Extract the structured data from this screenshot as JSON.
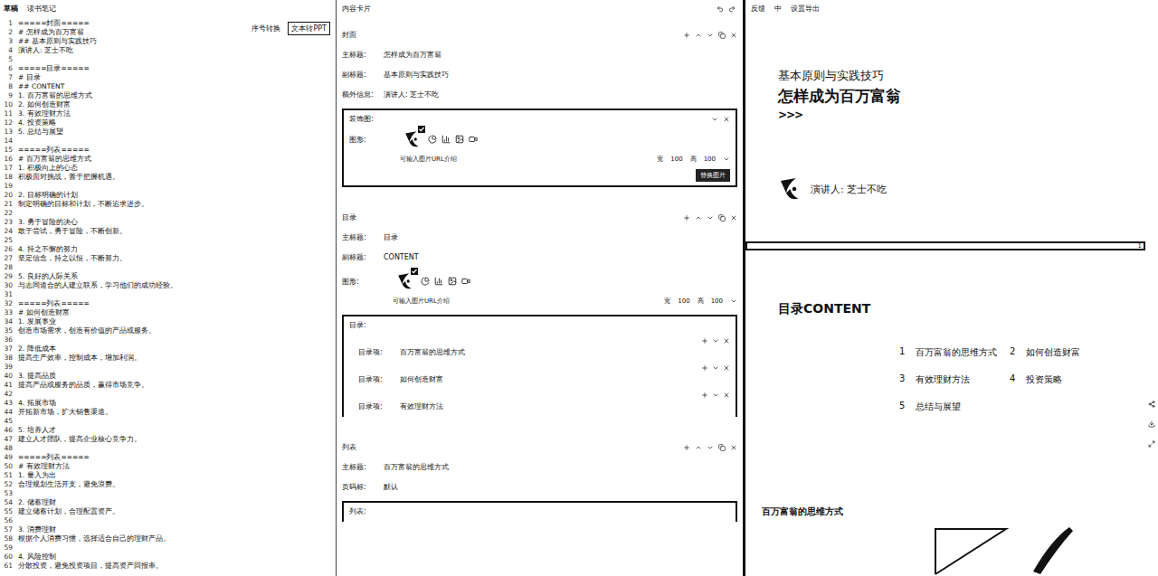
{
  "editor": {
    "tabs": [
      {
        "label": "草稿",
        "selected": true
      },
      {
        "label": "读书笔记",
        "selected": false
      }
    ],
    "buttons": [
      {
        "label": "序号转换",
        "selected": false
      },
      {
        "label": "文本转PPT",
        "selected": true
      }
    ],
    "lines": [
      {
        "n": "1",
        "text": "=====封面====="
      },
      {
        "n": "2",
        "text": "# 怎样成为百万富翁"
      },
      {
        "n": "3",
        "text": "## 基本原则与实践技巧"
      },
      {
        "n": "4",
        "text": "演讲人: 芝士不吃"
      },
      {
        "n": "5",
        "text": ""
      },
      {
        "n": "6",
        "text": "=====目录====="
      },
      {
        "n": "7",
        "text": "# 目录"
      },
      {
        "n": "8",
        "text": "## CONTENT"
      },
      {
        "n": "9",
        "text": "1. 百万富翁的思维方式"
      },
      {
        "n": "10",
        "text": "2. 如何创造财富"
      },
      {
        "n": "11",
        "text": "3. 有效理财方法"
      },
      {
        "n": "12",
        "text": "4. 投资策略"
      },
      {
        "n": "13",
        "text": "5. 总结与展望"
      },
      {
        "n": "14",
        "text": ""
      },
      {
        "n": "15",
        "text": "=====列表====="
      },
      {
        "n": "16",
        "text": "# 百万富翁的思维方式"
      },
      {
        "n": "17",
        "text": "1. 积极向上的心态"
      },
      {
        "n": "18",
        "text": "积极面对挑战，善于把握机遇。"
      },
      {
        "n": "19",
        "text": ""
      },
      {
        "n": "20",
        "text": "2. 目标明确的计划"
      },
      {
        "n": "21",
        "text": "制定明确的目标和计划，不断追求进步。"
      },
      {
        "n": "22",
        "text": ""
      },
      {
        "n": "23",
        "text": "3. 勇于冒险的决心"
      },
      {
        "n": "24",
        "text": "敢于尝试，勇于冒险，不断创新。"
      },
      {
        "n": "25",
        "text": ""
      },
      {
        "n": "26",
        "text": "4. 持之不懈的努力"
      },
      {
        "n": "27",
        "text": "坚定信念，持之以恒，不断努力。"
      },
      {
        "n": "28",
        "text": ""
      },
      {
        "n": "29",
        "text": "5. 良好的人际关系"
      },
      {
        "n": "30",
        "text": "与志同道合的人建立联系，学习他们的成功经验。"
      },
      {
        "n": "31",
        "text": ""
      },
      {
        "n": "32",
        "text": "=====列表====="
      },
      {
        "n": "33",
        "text": "# 如何创造财富"
      },
      {
        "n": "34",
        "text": "1. 发展事业"
      },
      {
        "n": "35",
        "text": "创造市场需求，创造有价值的产品或服务。"
      },
      {
        "n": "36",
        "text": ""
      },
      {
        "n": "37",
        "text": "2. 降低成本"
      },
      {
        "n": "38",
        "text": "提高生产效率，控制成本，增加利润。"
      },
      {
        "n": "39",
        "text": ""
      },
      {
        "n": "40",
        "text": "3. 提高品质"
      },
      {
        "n": "41",
        "text": "提高产品或服务的品质，赢得市场竞争。"
      },
      {
        "n": "42",
        "text": ""
      },
      {
        "n": "43",
        "text": "4. 拓展市场"
      },
      {
        "n": "44",
        "text": "开拓新市场，扩大销售渠道。"
      },
      {
        "n": "45",
        "text": ""
      },
      {
        "n": "46",
        "text": "5. 培养人才"
      },
      {
        "n": "47",
        "text": "建立人才团队，提高企业核心竞争力。"
      },
      {
        "n": "48",
        "text": ""
      },
      {
        "n": "49",
        "text": "=====列表====="
      },
      {
        "n": "50",
        "text": "# 有效理财方法"
      },
      {
        "n": "51",
        "text": "1. 量入为出"
      },
      {
        "n": "52",
        "text": "合理规划生活开支，避免浪费。"
      },
      {
        "n": "53",
        "text": ""
      },
      {
        "n": "54",
        "text": "2. 储蓄理财"
      },
      {
        "n": "55",
        "text": "建立储蓄计划，合理配置资产。"
      },
      {
        "n": "56",
        "text": ""
      },
      {
        "n": "57",
        "text": "3. 消费理财"
      },
      {
        "n": "58",
        "text": "根据个人消费习惯，选择适合自己的理财产品。"
      },
      {
        "n": "59",
        "text": ""
      },
      {
        "n": "60",
        "text": "4. 风险控制"
      },
      {
        "n": "61",
        "text": "分散投资，避免投资项目，提高资产回报率。"
      }
    ]
  },
  "cards": {
    "title": "内容卡片",
    "items": [
      {
        "title": "封面",
        "fields": [
          {
            "label": "主标题:",
            "value": "怎样成为百万富翁"
          },
          {
            "label": "副标题:",
            "value": "基本原则与实践技巧"
          },
          {
            "label": "额外信息:",
            "value": "演讲人: 芝士不吃"
          }
        ],
        "figure": {
          "boxed": true,
          "box_title": "装饰图:",
          "label": "图形:",
          "hint": "可输入图片URL介绍",
          "width_label": "宽",
          "width": "100",
          "height_label": "高",
          "height": "100",
          "button": "替换图片"
        },
        "list": null
      },
      {
        "title": "目录",
        "fields": [
          {
            "label": "主标题:",
            "value": "目录"
          },
          {
            "label": "副标题:",
            "value": "CONTENT"
          }
        ],
        "figure": {
          "boxed": false,
          "box_title": "",
          "label": "图形:",
          "hint": "可输入图片URL介绍",
          "width_label": "宽",
          "width": "100",
          "height_label": "高",
          "height": "100",
          "button": ""
        },
        "list": {
          "title": "目录:",
          "items": [
            {
              "label": "目录项:",
              "value": "百万富翁的思维方式"
            },
            {
              "label": "目录项:",
              "value": "如何创造财富"
            },
            {
              "label": "目录项:",
              "value": "有效理财方法"
            }
          ]
        }
      },
      {
        "title": "列表",
        "fields": [
          {
            "label": "主标题:",
            "value": "百万富翁的思维方式"
          },
          {
            "label": "页码标:",
            "value": "默认"
          }
        ],
        "figure": null,
        "list": {
          "title": "列表:",
          "items": []
        }
      }
    ]
  },
  "preview": {
    "toolbar": [
      "反馈",
      "中",
      "设置导出"
    ],
    "cover": {
      "subtitle": "基本原则与实践技巧",
      "title": "怎样成为百万富翁",
      "arrows": ">>>",
      "speaker": "演讲人: 芝士不吃"
    },
    "page_number": "1",
    "toc": {
      "title": "目录CONTENT",
      "items": [
        {
          "num": "1",
          "text": "百万富翁的思维方式"
        },
        {
          "num": "2",
          "text": "如何创造财富"
        },
        {
          "num": "3",
          "text": "有效理财方法"
        },
        {
          "num": "4",
          "text": "投资策略"
        },
        {
          "num": "5",
          "text": "总结与展望"
        }
      ]
    },
    "list_slide": {
      "title": "百万富翁的思维方式"
    }
  }
}
